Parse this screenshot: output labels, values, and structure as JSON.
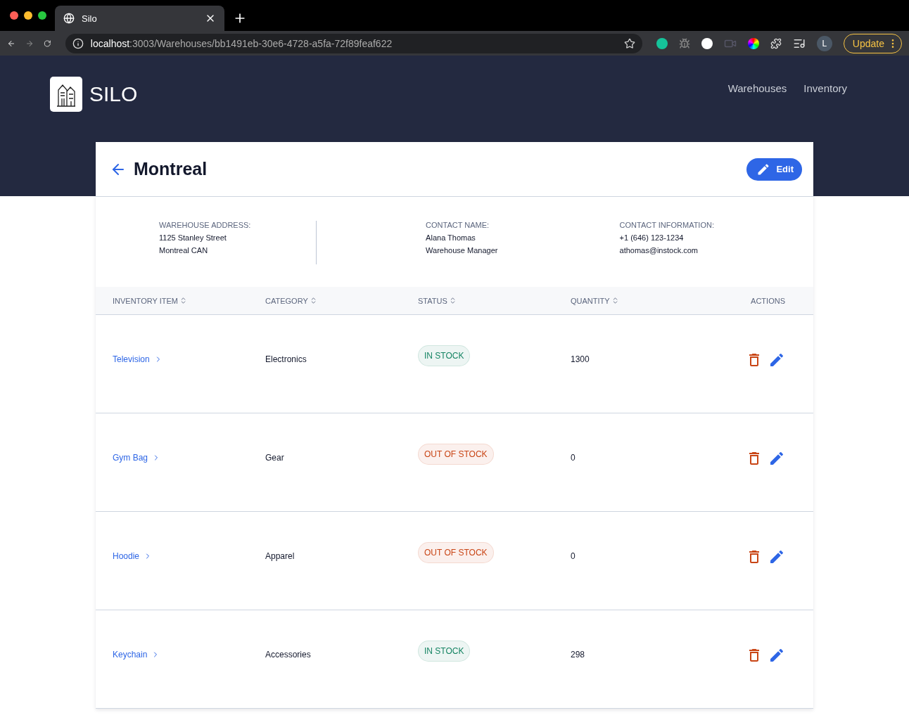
{
  "browser": {
    "tab_title": "Silo",
    "url_host": "localhost",
    "url_path": ":3003/Warehouses/bb1491eb-30e6-4728-a5fa-72f89feaf622",
    "profile_initial": "L",
    "update_label": "Update"
  },
  "header": {
    "brand": "SILO",
    "nav": [
      {
        "label": "Warehouses"
      },
      {
        "label": "Inventory"
      }
    ]
  },
  "page": {
    "title": "Montreal",
    "edit_label": "Edit"
  },
  "details": [
    {
      "label": "WAREHOUSE ADDRESS:",
      "lines": [
        "1125 Stanley Street",
        "Montreal CAN"
      ]
    },
    {
      "label": "CONTACT NAME:",
      "lines": [
        "Alana Thomas",
        "Warehouse Manager"
      ]
    },
    {
      "label": "CONTACT INFORMATION:",
      "lines": [
        "+1 (646) 123-1234",
        "athomas@instock.com"
      ]
    }
  ],
  "table": {
    "columns": [
      {
        "label": "INVENTORY ITEM",
        "sortable": true
      },
      {
        "label": "CATEGORY",
        "sortable": true
      },
      {
        "label": "STATUS",
        "sortable": true
      },
      {
        "label": "QUANTITY",
        "sortable": true
      },
      {
        "label": "ACTIONS",
        "sortable": false
      }
    ],
    "rows": [
      {
        "item": "Television",
        "category": "Electronics",
        "status": "IN STOCK",
        "color": "#158463",
        "quantity": "1300"
      },
      {
        "item": "Gym Bag",
        "category": "Gear",
        "status": "OUT OF STOCK",
        "color": "#c94515",
        "quantity": "0"
      },
      {
        "item": "Hoodie",
        "category": "Apparel",
        "status": "OUT OF STOCK",
        "color": "#c94515",
        "quantity": "0"
      },
      {
        "item": "Keychain",
        "category": "Accessories",
        "status": "IN STOCK",
        "color": "#158463",
        "quantity": "298"
      }
    ]
  }
}
